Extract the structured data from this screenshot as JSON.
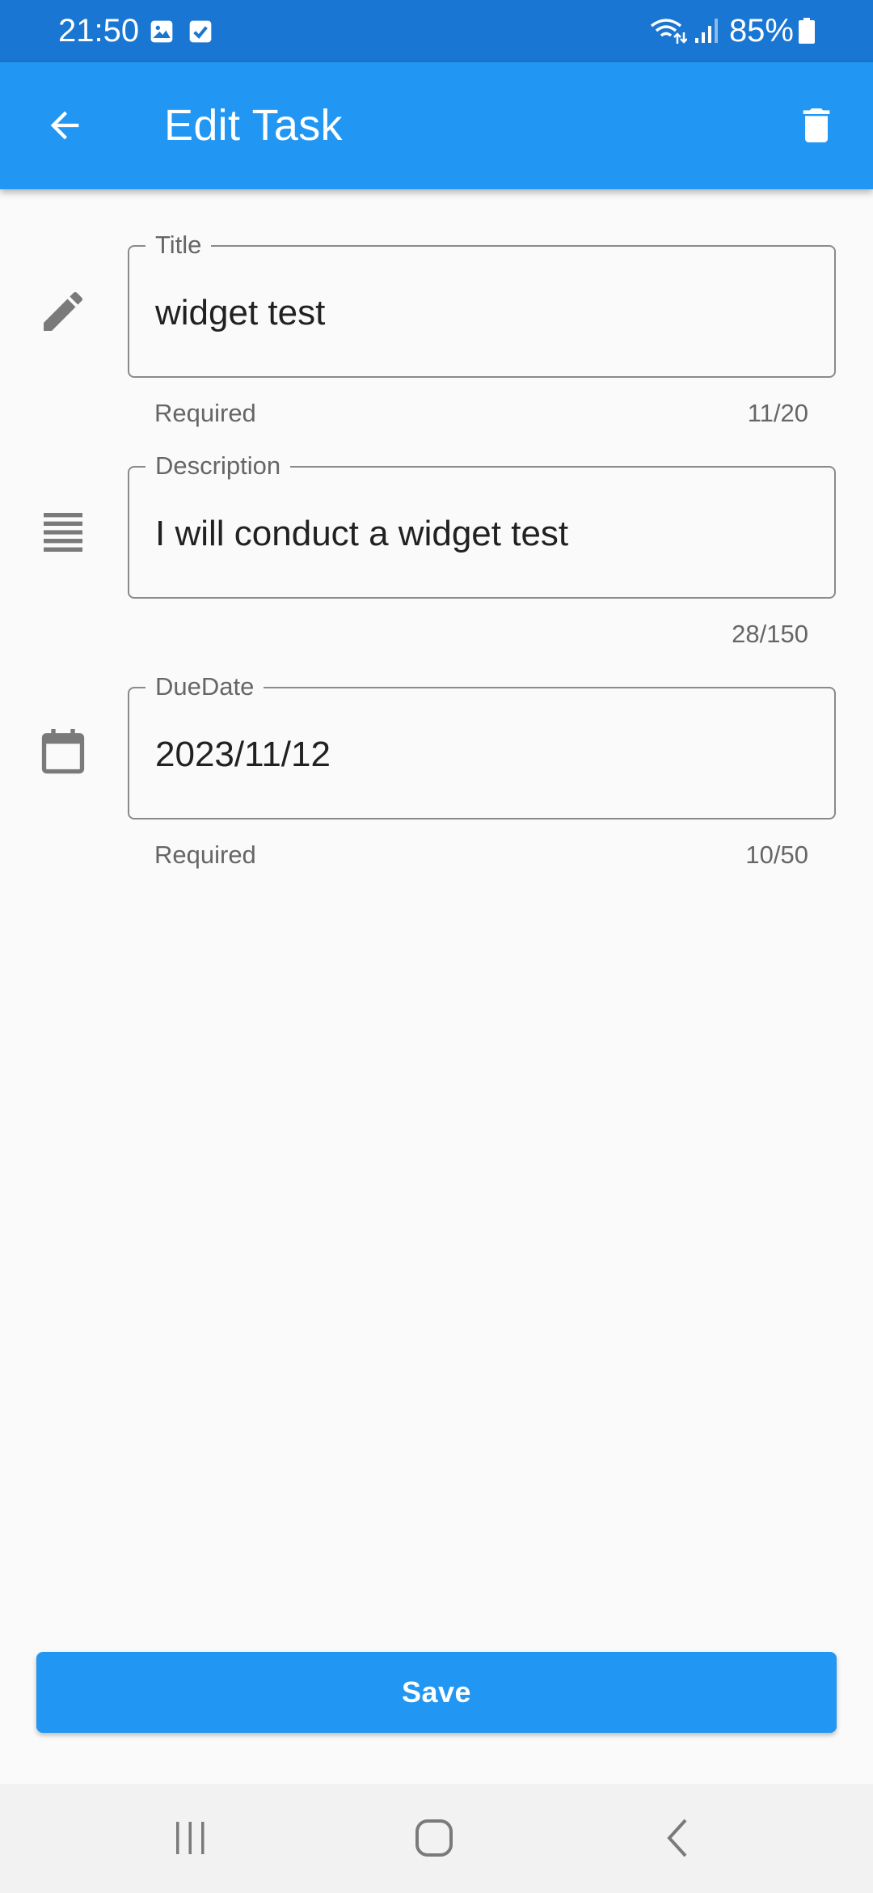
{
  "status_bar": {
    "time": "21:50",
    "battery": "85%",
    "icons": [
      "image-icon",
      "check-square-icon",
      "wifi-icon",
      "signal-icon",
      "battery-icon"
    ]
  },
  "app_bar": {
    "title": "Edit Task",
    "back_icon": "arrow-back-icon",
    "delete_icon": "trash-icon",
    "color": "#2196f3"
  },
  "form": {
    "title_field": {
      "label": "Title",
      "value": "widget test",
      "helper": "Required",
      "counter": "11/20",
      "icon": "pencil-icon"
    },
    "description_field": {
      "label": "Description",
      "value": "I will conduct a widget test",
      "helper": "",
      "counter": "28/150",
      "icon": "notes-icon"
    },
    "due_date_field": {
      "label": "DueDate",
      "value": "2023/11/12",
      "helper": "Required",
      "counter": "10/50",
      "icon": "calendar-icon"
    }
  },
  "save_button": {
    "label": "Save"
  },
  "nav_bar": {
    "icons": [
      "recent-apps-icon",
      "home-icon",
      "back-icon"
    ]
  }
}
